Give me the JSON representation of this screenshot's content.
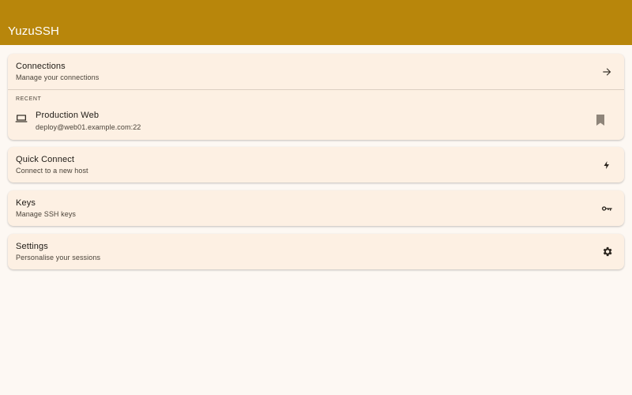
{
  "app": {
    "title": "YuzuSSH"
  },
  "colors": {
    "appbar": "#b8860b",
    "card": "#fdf0e3",
    "background": "#fdf8f3"
  },
  "connections": {
    "title": "Connections",
    "subtitle": "Manage your connections",
    "icon": "arrow-right-icon",
    "recent_label": "RECENT",
    "recent": [
      {
        "title": "Production Web",
        "subtitle": "deploy@web01.example.com:22",
        "icon": "laptop-icon",
        "trailing_icon": "bookmark-icon"
      }
    ]
  },
  "quick_connect": {
    "title": "Quick Connect",
    "subtitle": "Connect to a new host",
    "icon": "bolt-icon"
  },
  "keys": {
    "title": "Keys",
    "subtitle": "Manage SSH keys",
    "icon": "key-icon"
  },
  "settings": {
    "title": "Settings",
    "subtitle": "Personalise your sessions",
    "icon": "gear-icon"
  }
}
